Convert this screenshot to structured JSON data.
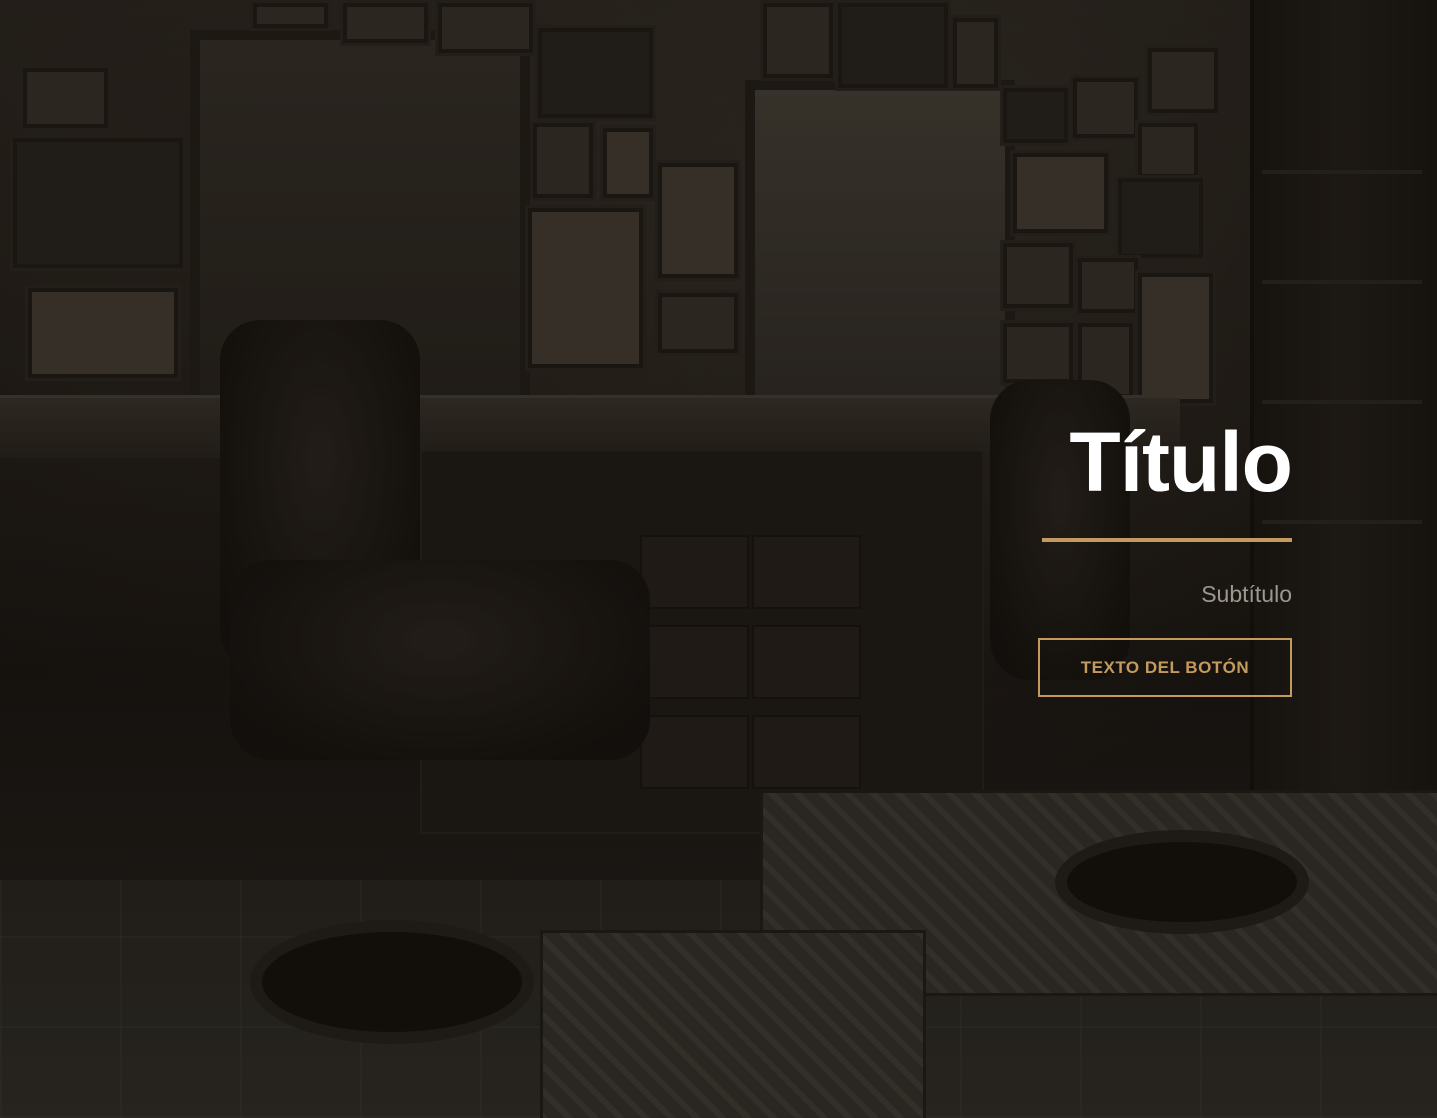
{
  "hero": {
    "title": "Título",
    "subtitle": "Subtítulo",
    "button_label": "TEXTO DEL BOTÓN",
    "background_image": "barbershop-interior",
    "colors": {
      "accent": "#c49a5e",
      "title": "#ffffff",
      "subtitle": "#9c978f",
      "background": "#17130f"
    }
  }
}
